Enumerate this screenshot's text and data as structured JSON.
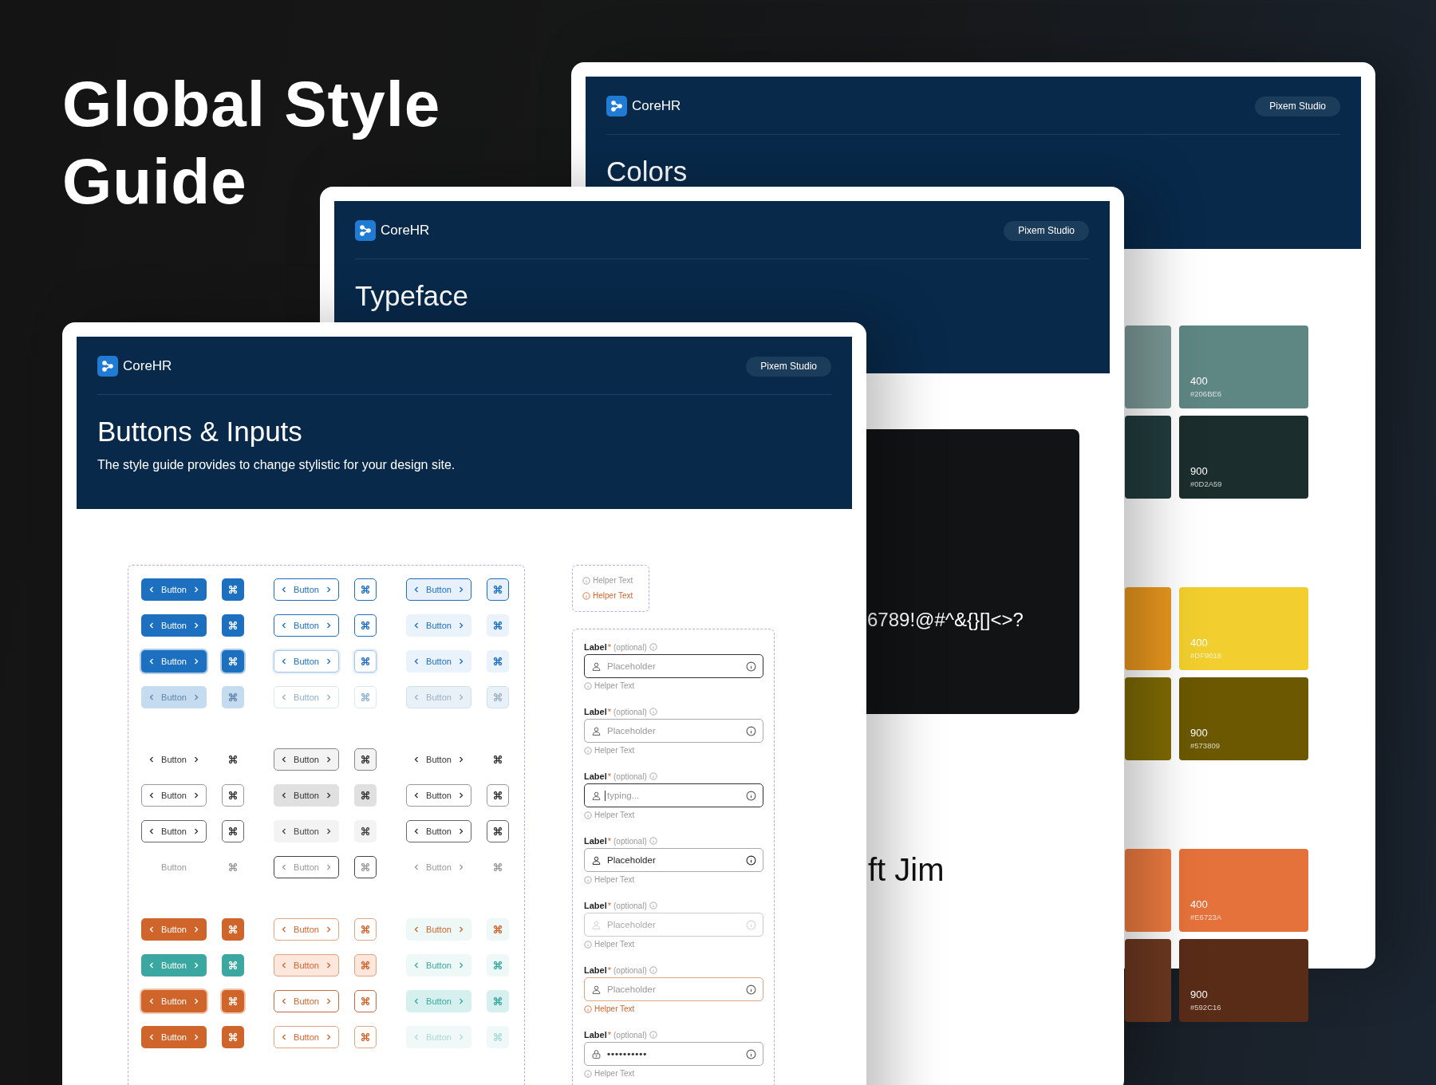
{
  "title": "Global Style Guide",
  "colors_page": {
    "brand": "CoreHR",
    "studio": "Pixem Studio",
    "heading": "Colors",
    "swatch_groups": [
      {
        "rows": [
          {
            "left": {
              "color": "#7b9997"
            },
            "right": {
              "color": "#5e8683",
              "shade": "400",
              "hex": "#206BE6"
            }
          },
          {
            "left": {
              "color": "#213b3c"
            },
            "right": {
              "color": "#1b2d2c",
              "shade": "900",
              "hex": "#0D2A59"
            }
          }
        ]
      },
      {
        "rows": [
          {
            "left": {
              "color": "#e8961e"
            },
            "right": {
              "color": "#f2cf2e",
              "shade": "400",
              "hex": "#DF9018"
            }
          },
          {
            "left": {
              "color": "#7e6a04"
            },
            "right": {
              "color": "#6b5800",
              "shade": "900",
              "hex": "#573809"
            }
          }
        ]
      },
      {
        "rows": [
          {
            "left": {
              "color": "#ec7a40"
            },
            "right": {
              "color": "#e5723a",
              "shade": "400",
              "hex": "#E6723A"
            }
          },
          {
            "left": {
              "color": "#6c3820"
            },
            "right": {
              "color": "#592c18",
              "shade": "900",
              "hex": "#592C16"
            }
          }
        ]
      }
    ]
  },
  "typeface_page": {
    "brand": "CoreHR",
    "studio": "Pixem Studio",
    "heading": "Typeface",
    "glyph_sample": "6789!@#^&{}[]<>?",
    "name_sample": "ft Jim"
  },
  "buttons_page": {
    "brand": "CoreHR",
    "studio": "Pixem Studio",
    "heading": "Buttons & Inputs",
    "description": "The style guide provides to change stylistic for your design site.",
    "button_sections": [
      {
        "rows": [
          [
            {
              "kind": "blue-solid",
              "label": "Button"
            },
            {
              "kind": "blue-outline",
              "label": "Button"
            },
            {
              "kind": "blue-soft-outline",
              "label": "Button"
            }
          ],
          [
            {
              "kind": "blue-solid",
              "label": "Button"
            },
            {
              "kind": "blue-outline",
              "label": "Button"
            },
            {
              "kind": "blue-soft",
              "label": "Button"
            }
          ],
          [
            {
              "kind": "blue-solid-ring",
              "label": "Button"
            },
            {
              "kind": "blue-outline-ring",
              "label": "Button"
            },
            {
              "kind": "blue-soft",
              "label": "Button"
            }
          ],
          [
            {
              "kind": "blue-solid-disabled",
              "label": "Button"
            },
            {
              "kind": "blue-outline-disabled",
              "label": "Button"
            },
            {
              "kind": "blue-soft-disabled",
              "label": "Button"
            }
          ]
        ]
      },
      {
        "rows": [
          [
            {
              "kind": "ghost",
              "label": "Button"
            },
            {
              "kind": "gray-soft-outline",
              "label": "Button"
            },
            {
              "kind": "ghost",
              "label": "Button"
            }
          ],
          [
            {
              "kind": "neutral-outline",
              "label": "Button"
            },
            {
              "kind": "gray-solid",
              "label": "Button"
            },
            {
              "kind": "neutral-outline",
              "label": "Button"
            }
          ],
          [
            {
              "kind": "neutral-dark-outline",
              "label": "Button"
            },
            {
              "kind": "gray-soft",
              "label": "Button"
            },
            {
              "kind": "neutral-dark-outline",
              "label": "Button"
            }
          ],
          [
            {
              "kind": "ghost-plain-disabled",
              "label": "Button"
            },
            {
              "kind": "dark-outline-disabled",
              "label": "Button"
            },
            {
              "kind": "ghost-disabled",
              "label": "Button"
            }
          ]
        ]
      },
      {
        "rows": [
          [
            {
              "kind": "orange-solid",
              "label": "Button"
            },
            {
              "kind": "orange-outline",
              "label": "Button"
            },
            {
              "kind": "teal-soft-orange",
              "label": "Button"
            }
          ],
          [
            {
              "kind": "teal-solid",
              "label": "Button"
            },
            {
              "kind": "orange-tint",
              "label": "Button"
            },
            {
              "kind": "teal-soft",
              "label": "Button"
            }
          ],
          [
            {
              "kind": "orange-solid-ring",
              "label": "Button"
            },
            {
              "kind": "orange-outline-ring",
              "label": "Button"
            },
            {
              "kind": "teal-soft-strong",
              "label": "Button"
            }
          ],
          [
            {
              "kind": "orange-solid",
              "label": "Button"
            },
            {
              "kind": "orange-outline",
              "label": "Button"
            },
            {
              "kind": "teal-soft-disabled",
              "label": "Button"
            }
          ]
        ]
      }
    ],
    "helper_examples": [
      {
        "kind": "default",
        "text": "Helper Text"
      },
      {
        "kind": "error",
        "text": "Helper Text"
      }
    ],
    "inputs": [
      {
        "kind": "focused",
        "label": "Label",
        "required": "*",
        "hint": "(optional)",
        "placeholder": "Placeholder",
        "helper": "Helper Text"
      },
      {
        "kind": "hover",
        "label": "Label",
        "required": "*",
        "hint": "(optional)",
        "placeholder": "Placeholder",
        "helper": "Helper Text"
      },
      {
        "kind": "typing",
        "label": "Label",
        "required": "*",
        "hint": "(optional)",
        "placeholder": "typing...",
        "helper": "Helper Text"
      },
      {
        "kind": "filled",
        "label": "Label",
        "required": "*",
        "hint": "(optional)",
        "value": "Placeholder",
        "helper": "Helper Text"
      },
      {
        "kind": "disabled",
        "label": "Label",
        "required": "*",
        "hint": "(optional)",
        "placeholder": "Placeholder",
        "helper": "Helper Text"
      },
      {
        "kind": "error",
        "label": "Label",
        "required": "*",
        "hint": "(optional)",
        "placeholder": "Placeholder",
        "helper": "Helper Text"
      },
      {
        "kind": "password",
        "label": "Label",
        "required": "*",
        "hint": "(optional)",
        "value": "••••••••••",
        "helper": "Helper Text"
      }
    ]
  }
}
